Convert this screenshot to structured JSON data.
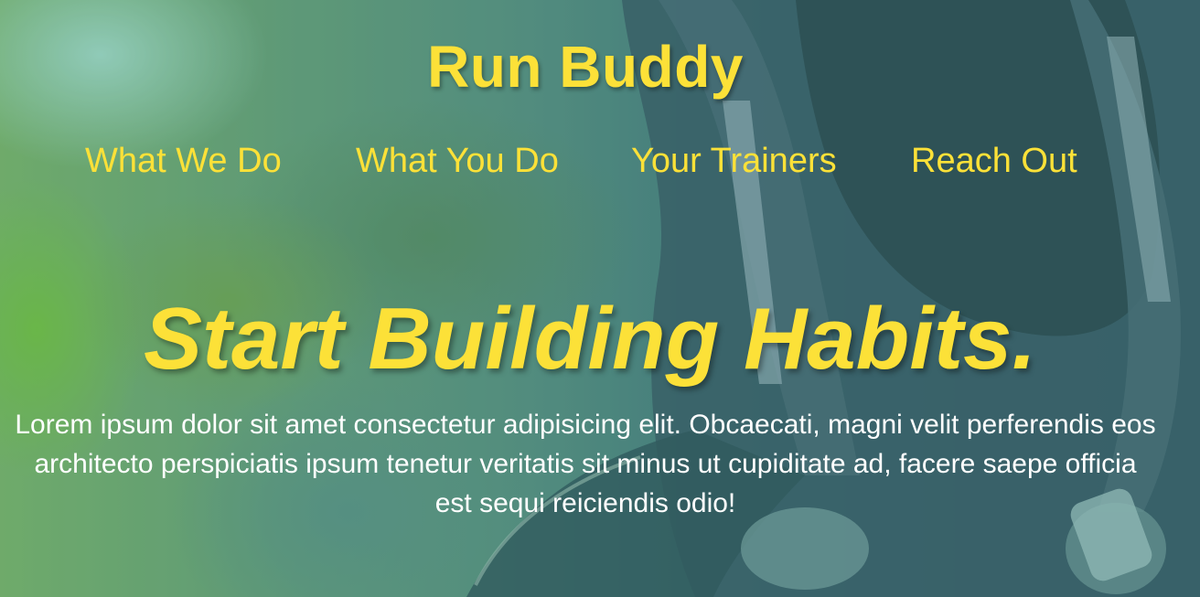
{
  "header": {
    "title": "Run Buddy"
  },
  "nav": {
    "items": [
      {
        "label": "What We Do"
      },
      {
        "label": "What You Do"
      },
      {
        "label": "Your Trainers"
      },
      {
        "label": "Reach Out"
      }
    ]
  },
  "hero": {
    "headline": "Start Building Habits.",
    "intro": "Lorem ipsum dolor sit amet consectetur adipisicing elit. Obcaecati, magni velit perferendis eos architecto perspiciatis ipsum tenetur veritatis sit minus ut cupiditate ad, facere saepe officia est sequi reiciendis odio!"
  },
  "colors": {
    "accent": "#fce138",
    "body_text": "#ffffff",
    "overlay": "#3a6a70"
  }
}
